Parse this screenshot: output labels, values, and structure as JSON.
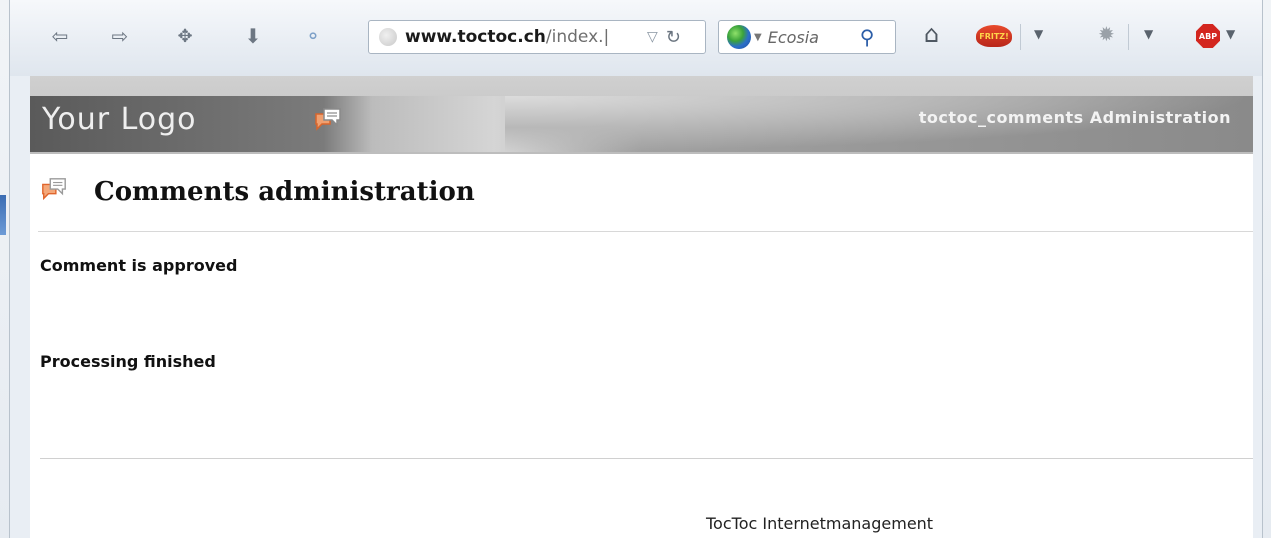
{
  "browser": {
    "url_host": "www.toctoc.ch",
    "url_path": "/index.|",
    "search_engine": "Ecosia",
    "fritz_label": "FRITZ!",
    "abp_label": "ABP"
  },
  "admin_header": {
    "logo": "Your Logo",
    "title": "toctoc_comments Administration"
  },
  "main": {
    "heading": "Comments administration",
    "message_approved": "Comment is approved",
    "message_finished": "Processing finished"
  },
  "footer": {
    "text": "TocToc Internetmanagement"
  },
  "colors": {
    "chat_icon": "#f07a3a",
    "header_gray": "#8a8a8a"
  }
}
